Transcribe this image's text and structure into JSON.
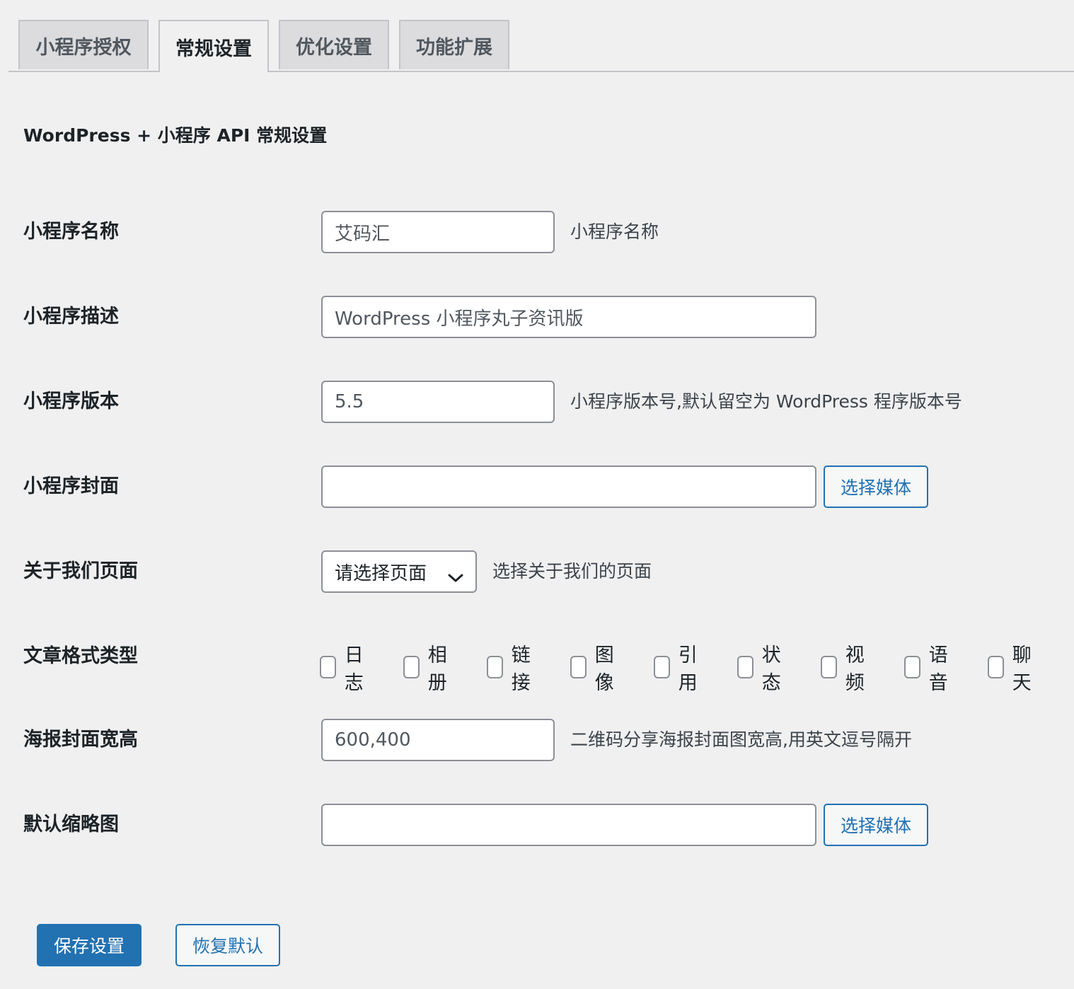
{
  "tabs": [
    {
      "label": "小程序授权",
      "active": false
    },
    {
      "label": "常规设置",
      "active": true
    },
    {
      "label": "优化设置",
      "active": false
    },
    {
      "label": "功能扩展",
      "active": false
    }
  ],
  "section_title": "WordPress + 小程序 API 常规设置",
  "fields": {
    "app_name": {
      "label": "小程序名称",
      "value": "艾码汇",
      "description": "小程序名称"
    },
    "app_desc": {
      "label": "小程序描述",
      "value": "WordPress 小程序丸子资讯版"
    },
    "app_version": {
      "label": "小程序版本",
      "value": "5.5",
      "description": "小程序版本号,默认留空为 WordPress 程序版本号"
    },
    "app_cover": {
      "label": "小程序封面",
      "value": "",
      "button": "选择媒体"
    },
    "about_page": {
      "label": "关于我们页面",
      "selected": "请选择页面",
      "description": "选择关于我们的页面"
    },
    "post_formats": {
      "label": "文章格式类型",
      "options": [
        "日志",
        "相册",
        "链接",
        "图像",
        "引用",
        "状态",
        "视频",
        "语音",
        "聊天"
      ]
    },
    "poster_size": {
      "label": "海报封面宽高",
      "value": "600,400",
      "description": "二维码分享海报封面图宽高,用英文逗号隔开"
    },
    "default_thumb": {
      "label": "默认缩略图",
      "value": "",
      "button": "选择媒体"
    }
  },
  "actions": {
    "save": "保存设置",
    "reset": "恢复默认"
  },
  "colors": {
    "accent": "#2271b1",
    "background": "#f0f0f1",
    "border": "#8c8f94"
  }
}
